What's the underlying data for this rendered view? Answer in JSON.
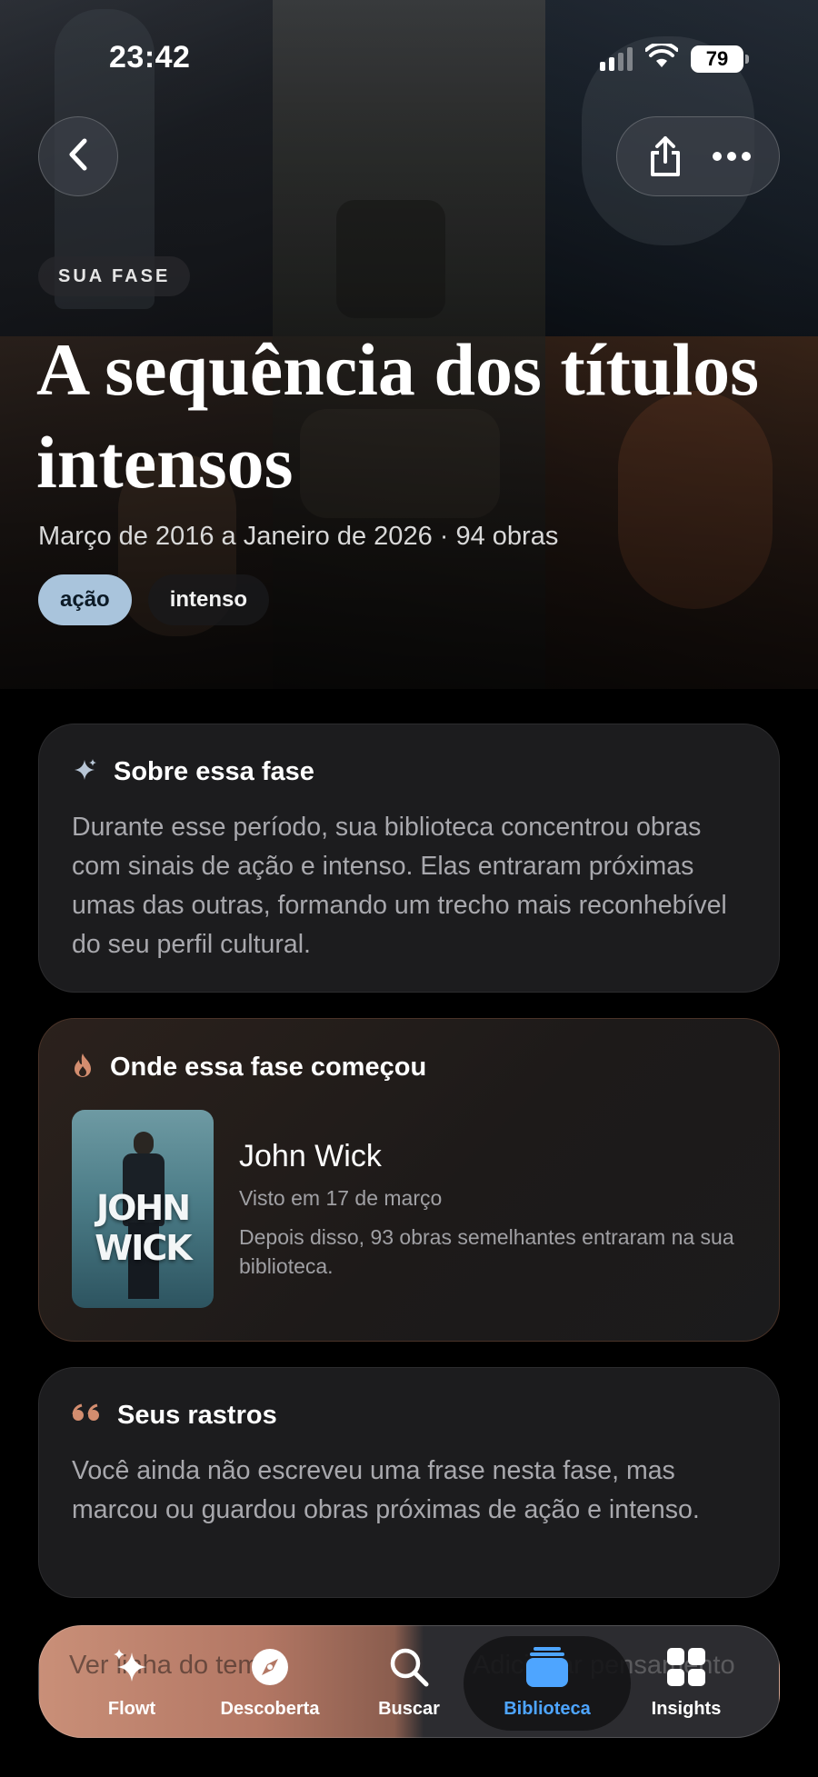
{
  "status_bar": {
    "time": "23:42",
    "battery": "79"
  },
  "hero": {
    "badge": "SUA FASE",
    "title": "A sequência dos títulos intensos",
    "subtitle": "Março de 2016 a Janeiro de 2026 · 94 obras",
    "tags": [
      {
        "label": "ação",
        "active": true
      },
      {
        "label": "intenso",
        "active": false
      }
    ]
  },
  "about": {
    "title": "Sobre essa fase",
    "icon": "sparkles-icon",
    "body": "Durante esse período, sua biblioteca concentrou obras com sinais de ação e intenso. Elas entraram próximas umas das outras, formando um trecho mais reconhebível do seu perfil cultural."
  },
  "origin": {
    "title": "Onde essa fase começou",
    "icon": "flame-icon",
    "poster_text": "JOHN WICK",
    "movie_title": "John Wick",
    "seen": "Visto em 17 de março",
    "description": "Depois disso, 93 obras semelhantes entraram na sua biblioteca.",
    "accent": "#c98f78"
  },
  "traces": {
    "title": "Seus rastros",
    "icon": "quote-icon",
    "body": "Você ainda não escreveu uma frase nesta fase, mas marcou ou guardou obras próximas de ação e intenso."
  },
  "peek": {
    "left": "Ver linha do tempo",
    "right": "Adicionar pensamento"
  },
  "tab_bar": {
    "items": [
      {
        "label": "Flowt",
        "icon": "sparkles-icon"
      },
      {
        "label": "Descoberta",
        "icon": "compass-icon"
      },
      {
        "label": "Buscar",
        "icon": "search-icon"
      },
      {
        "label": "Biblioteca",
        "icon": "library-icon",
        "active": true
      },
      {
        "label": "Insights",
        "icon": "grid-icon"
      }
    ],
    "active_color": "#4ea5ff"
  }
}
